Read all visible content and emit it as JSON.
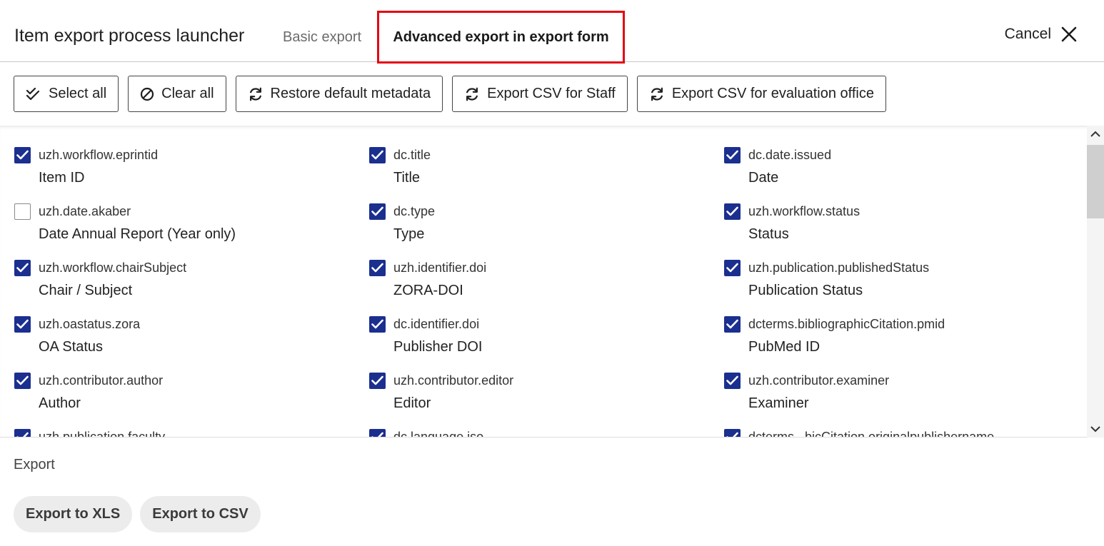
{
  "header": {
    "title": "Item export process launcher",
    "tabs": [
      {
        "label": "Basic export",
        "active": false
      },
      {
        "label": "Advanced export in export form",
        "active": true
      }
    ],
    "cancel_label": "Cancel"
  },
  "toolbar": {
    "select_all": "Select all",
    "clear_all": "Clear all",
    "restore_default": "Restore default metadata",
    "export_csv_staff": "Export CSV for Staff",
    "export_csv_evaluation": "Export CSV for evaluation office"
  },
  "fields": [
    [
      {
        "key": "uzh.workflow.eprintid",
        "label": "Item ID",
        "checked": true
      },
      {
        "key": "dc.title",
        "label": "Title",
        "checked": true
      },
      {
        "key": "dc.date.issued",
        "label": "Date",
        "checked": true
      }
    ],
    [
      {
        "key": "uzh.date.akaber",
        "label": "Date Annual Report (Year only)",
        "checked": false
      },
      {
        "key": "dc.type",
        "label": "Type",
        "checked": true
      },
      {
        "key": "uzh.workflow.status",
        "label": "Status",
        "checked": true
      }
    ],
    [
      {
        "key": "uzh.workflow.chairSubject",
        "label": "Chair / Subject",
        "checked": true
      },
      {
        "key": "uzh.identifier.doi",
        "label": "ZORA-DOI",
        "checked": true
      },
      {
        "key": "uzh.publication.publishedStatus",
        "label": "Publication Status",
        "checked": true
      }
    ],
    [
      {
        "key": "uzh.oastatus.zora",
        "label": "OA Status",
        "checked": true
      },
      {
        "key": "dc.identifier.doi",
        "label": "Publisher DOI",
        "checked": true
      },
      {
        "key": "dcterms.bibliographicCitation.pmid",
        "label": "PubMed ID",
        "checked": true
      }
    ],
    [
      {
        "key": "uzh.contributor.author",
        "label": "Author",
        "checked": true
      },
      {
        "key": "uzh.contributor.editor",
        "label": "Editor",
        "checked": true
      },
      {
        "key": "uzh.contributor.examiner",
        "label": "Examiner",
        "checked": true
      }
    ],
    [
      {
        "key": "uzh.publication.faculty",
        "label": "",
        "checked": true
      },
      {
        "key": "dc.language.iso",
        "label": "",
        "checked": true
      },
      {
        "key": "dcterms...bicCitation.originalpublishername",
        "label": "",
        "checked": true
      }
    ]
  ],
  "footer": {
    "heading": "Export",
    "export_xls": "Export to XLS",
    "export_csv": "Export to CSV"
  },
  "colors": {
    "checkbox": "#1b2f8f",
    "highlight": "#e30613"
  }
}
